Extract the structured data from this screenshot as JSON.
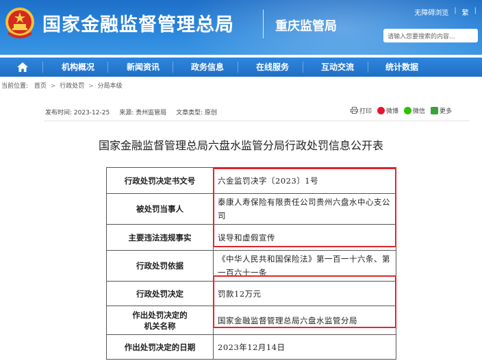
{
  "header": {
    "site_title": "国家金融监督管理总局",
    "branch_name": "重庆监管局",
    "top_links": [
      "无障碍浏览",
      "繁"
    ],
    "search_placeholder": "请输入您要搜索的内容..."
  },
  "nav": {
    "items": [
      "机构概况",
      "新闻资讯",
      "政务信息",
      "在线服务",
      "互动交流",
      "统计数据"
    ]
  },
  "breadcrumb": {
    "prefix": "当前位置:",
    "items": [
      "首页",
      "行政处罚",
      "分局本级"
    ]
  },
  "meta": {
    "publish_time": "发布时间: 2023-12-25",
    "source": "来源: 贵州监管局",
    "doc_type": "文章类型: 原创"
  },
  "share": {
    "print": "打印",
    "weibo": "微博",
    "wechat": "微信",
    "more": "更多"
  },
  "article": {
    "title": "国家金融监督管理总局六盘水监管分局行政处罚信息公开表"
  },
  "table": {
    "rows": [
      {
        "label": "行政处罚决定书文号",
        "value": "六金监罚决字〔2023〕1号"
      },
      {
        "label": "被处罚当事人",
        "value": "泰康人寿保险有限责任公司贵州六盘水中心支公司"
      },
      {
        "label": "主要违法违规事实",
        "value": "误导和虚假宣传"
      },
      {
        "label": "行政处罚依据",
        "value": "《中华人民共和国保险法》第一百一十六条、第一百六十一条"
      },
      {
        "label": "行政处罚决定",
        "value": "罚款12万元"
      },
      {
        "label": "作出处罚决定的机关名称",
        "label_line1": "作出处罚决定的",
        "label_line2": "机关名称",
        "value": "国家金融监督管理总局六盘水监管分局"
      },
      {
        "label": "作出处罚决定的日期",
        "value": "2023年12月14日"
      }
    ]
  },
  "colors": {
    "header_blue": "#2a86dc",
    "nav_blue": "#1f6fc4",
    "highlight_red": "#e0262a"
  }
}
